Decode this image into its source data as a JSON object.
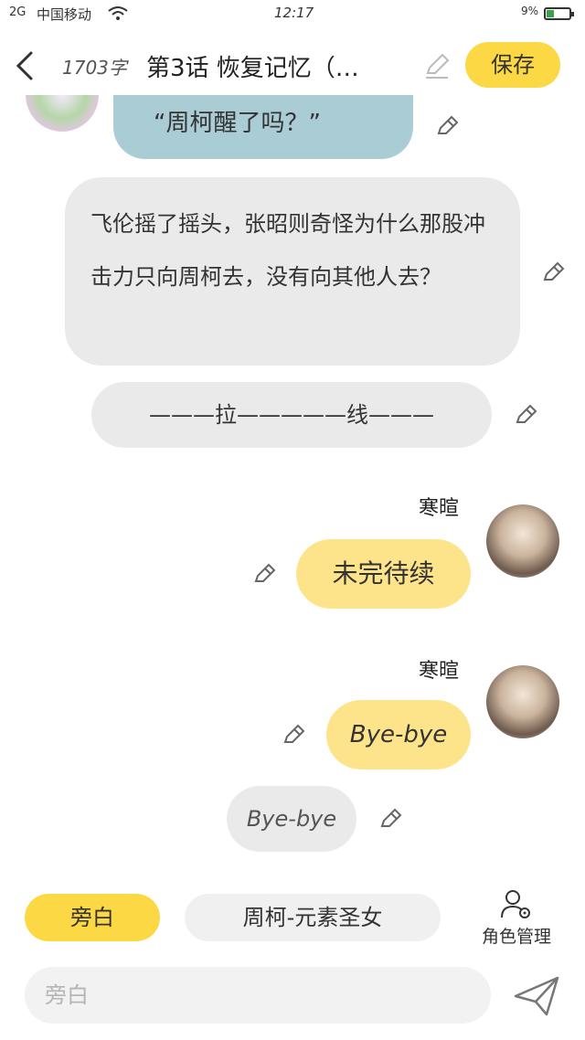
{
  "status_bar": {
    "signal": "2G",
    "carrier": "中国移动",
    "time": "12:17",
    "battery_percent": "9%"
  },
  "header": {
    "word_count": "1703字",
    "chapter_title": "第3话 恢复记忆（…",
    "save_label": "保存"
  },
  "messages": [
    {
      "type": "character-left",
      "text": "“周柯醒了吗？”"
    },
    {
      "type": "narration",
      "text": "飞伦摇了摇头，张昭则奇怪为什么那股冲击力只向周柯去，没有向其他人去？"
    },
    {
      "type": "narration",
      "text": "———拉—————线———"
    },
    {
      "type": "character-right",
      "speaker": "寒暄",
      "text": "未完待续"
    },
    {
      "type": "character-right",
      "speaker": "寒暄",
      "text": "Bye-bye"
    },
    {
      "type": "narration",
      "text": "Bye-bye"
    }
  ],
  "role_bar": {
    "narration_label": "旁白",
    "character_label": "周柯-元素圣女",
    "manage_label": "角色管理"
  },
  "input": {
    "placeholder": "旁白"
  },
  "colors": {
    "accent_yellow": "#fcd844",
    "bubble_teal": "#a9ccd5",
    "bubble_yellow": "#fde48a",
    "bubble_gray": "#eaeaea"
  },
  "icons": [
    "back-icon",
    "pencil-icon",
    "role-manage-icon",
    "send-icon",
    "wifi-icon",
    "battery-icon"
  ]
}
